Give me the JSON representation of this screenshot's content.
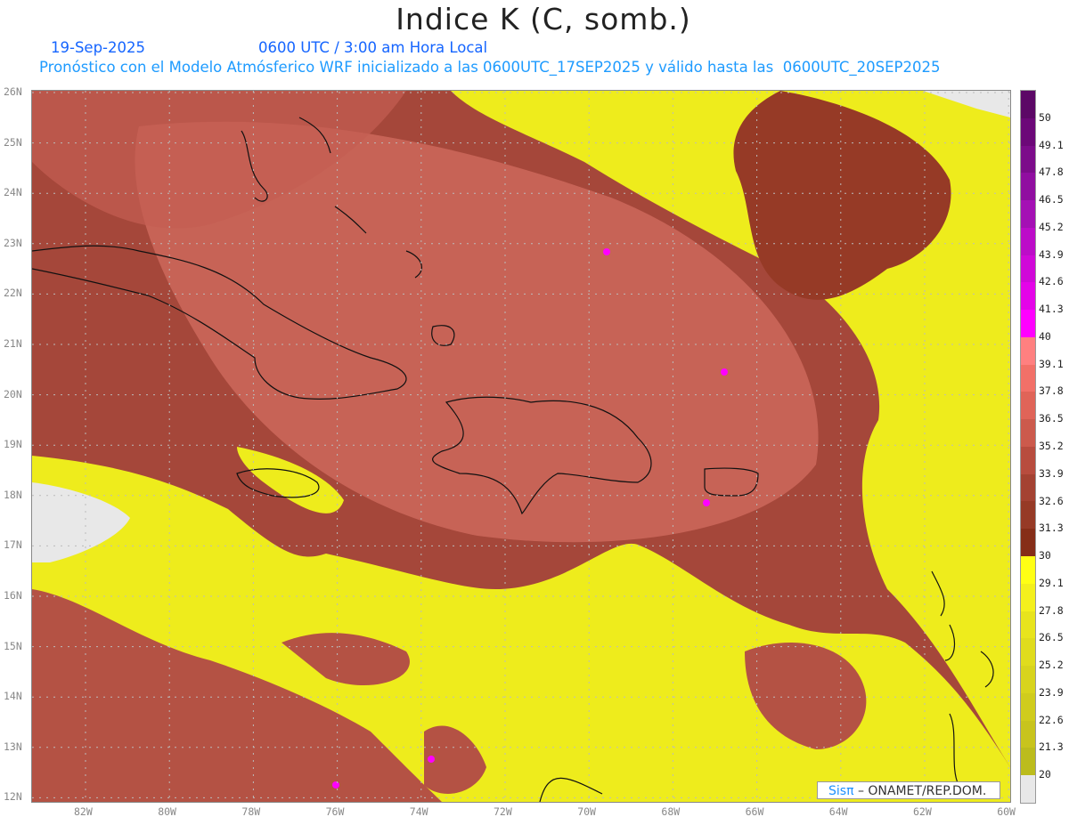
{
  "header": {
    "title": "Indice K (C, somb.)",
    "date": "19-Sep-2025",
    "time": "0600 UTC / 3:00 am Hora Local",
    "description": "Pronóstico con el Modelo Atmósferico WRF inicializado a las 0600UTC_17SEP2025 y válido hasta las  0600UTC_20SEP2025"
  },
  "axes": {
    "lat_labels": [
      "26N",
      "25N",
      "24N",
      "23N",
      "22N",
      "21N",
      "20N",
      "19N",
      "18N",
      "17N",
      "16N",
      "15N",
      "14N",
      "13N",
      "12N"
    ],
    "lon_labels": [
      "82W",
      "80W",
      "78W",
      "76W",
      "74W",
      "72W",
      "70W",
      "68W",
      "66W",
      "64W",
      "62W",
      "60W"
    ]
  },
  "colorbar": {
    "labels": [
      "50",
      "49.1",
      "47.8",
      "46.5",
      "45.2",
      "43.9",
      "42.6",
      "41.3",
      "40",
      "39.1",
      "37.8",
      "36.5",
      "35.2",
      "33.9",
      "32.6",
      "31.3",
      "30",
      "29.1",
      "27.8",
      "26.5",
      "25.2",
      "23.9",
      "22.6",
      "21.3",
      "20"
    ],
    "colors": [
      "#5c0866",
      "#6c0878",
      "#7c0c8a",
      "#900ea0",
      "#a410b4",
      "#bc0cc8",
      "#d008d8",
      "#e404e8",
      "#ff00ff",
      "#ff8080",
      "#f27068",
      "#e06458",
      "#cc5a4c",
      "#b84c3e",
      "#a44232",
      "#963a26",
      "#862e18",
      "#ffff14",
      "#f4f01c",
      "#e8e41c",
      "#e0dc1c",
      "#d8d41c",
      "#d0cc1c",
      "#c8c41c",
      "#bcbc1c",
      "#e8e8e8"
    ]
  },
  "credit": {
    "brand": "Sisπ",
    "text": " –  ONAMET/REP.DOM."
  }
}
